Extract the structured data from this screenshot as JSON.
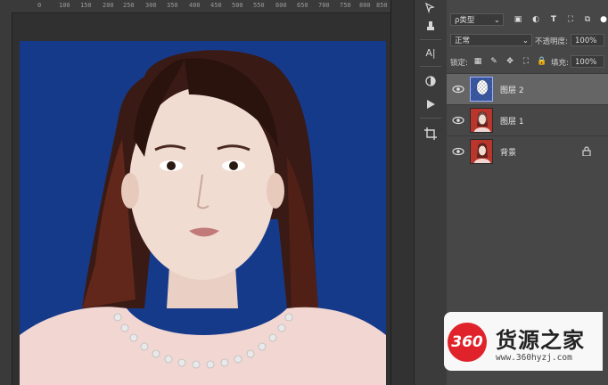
{
  "ruler": {
    "ticks": [
      "0",
      "100",
      "150",
      "200",
      "250",
      "300",
      "350",
      "400",
      "450",
      "500",
      "550",
      "600",
      "650",
      "700",
      "750",
      "800",
      "850"
    ]
  },
  "tools": {
    "items": [
      "path-select-icon",
      "stamp-icon",
      "character-panel-icon",
      "adjust-icon",
      "play-icon",
      "crop-icon"
    ],
    "char_label": "A|"
  },
  "layers_panel": {
    "filter_label": "ρ类型",
    "blend_mode": "正常",
    "opacity_label": "不透明度:",
    "opacity_value": "100%",
    "lock_label": "锁定:",
    "fill_label": "填充:",
    "fill_value": "100%",
    "layers": [
      {
        "name": "图层 2",
        "selected": true,
        "thumb": "transparent-person",
        "visible": true,
        "locked": false
      },
      {
        "name": "图层 1",
        "selected": false,
        "thumb": "red-person",
        "visible": true,
        "locked": false
      },
      {
        "name": "背景",
        "selected": false,
        "thumb": "red-person",
        "visible": true,
        "locked": true
      }
    ]
  },
  "watermark": {
    "logo_text": "360",
    "title": "货源之家",
    "url": "www.360hyzj.com"
  },
  "colors": {
    "photo_bg": "#163a8a",
    "logo_red": "#e0222b"
  }
}
